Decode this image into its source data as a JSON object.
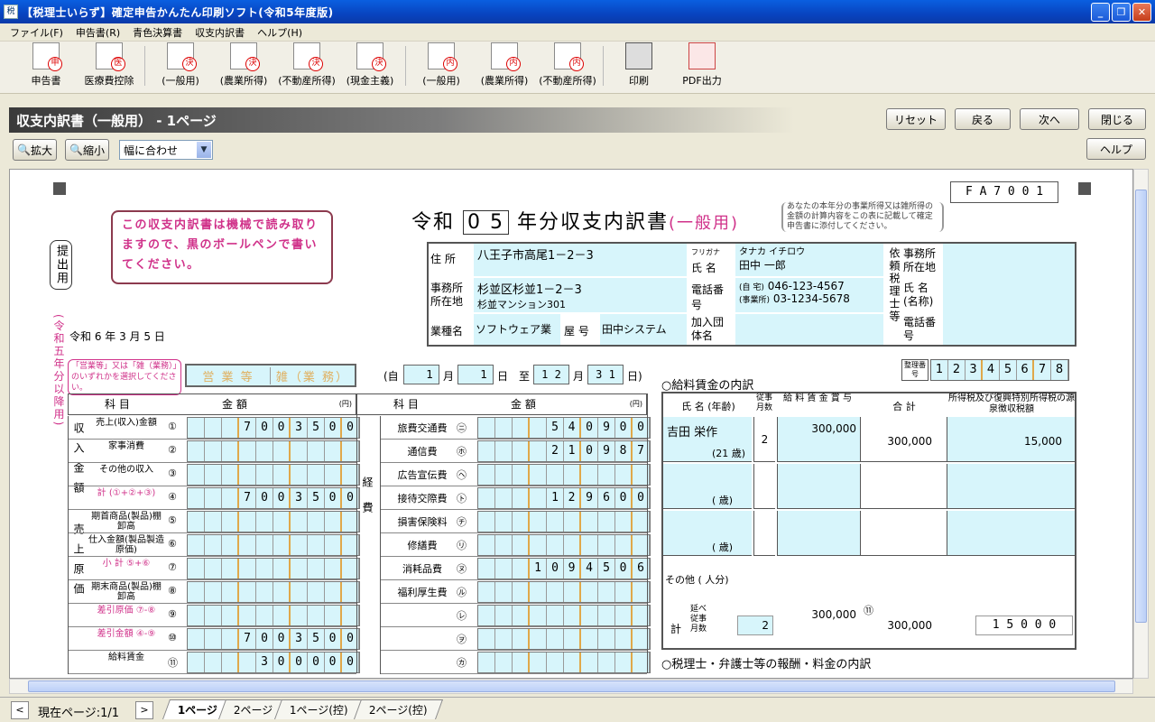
{
  "window": {
    "title": "【税理士いらず】確定申告かんたん印刷ソフト(令和5年度版)"
  },
  "menu": [
    "ファイル(F)",
    "申告書(R)",
    "青色決算書",
    "収支内訳書",
    "ヘルプ(H)"
  ],
  "toolbar": [
    {
      "label": "申告書",
      "badge": "申"
    },
    {
      "label": "医療費控除",
      "badge": "医"
    },
    {
      "label": "(一般用)",
      "badge": "決"
    },
    {
      "label": "(農業所得)",
      "badge": "決"
    },
    {
      "label": "(不動産所得)",
      "badge": "決"
    },
    {
      "label": "(現金主義)",
      "badge": "決"
    },
    {
      "label": "(一般用)",
      "badge": "内"
    },
    {
      "label": "(農業所得)",
      "badge": "内"
    },
    {
      "label": "(不動産所得)",
      "badge": "内"
    },
    {
      "label": "印刷",
      "badge": ""
    },
    {
      "label": "PDF出力",
      "badge": ""
    }
  ],
  "header": {
    "title": "収支内訳書（一般用） - 1ページ"
  },
  "nav": {
    "reset": "リセット",
    "back": "戻る",
    "next": "次へ",
    "close": "閉じる",
    "help": "ヘルプ"
  },
  "zoom": {
    "in": "拡大",
    "out": "縮小",
    "fit": "幅に合わせ"
  },
  "form": {
    "code": "F A 7 0 0 1",
    "title_pre": "令和",
    "year": "0 5",
    "title_post": "年分収支内訳書",
    "title_kind": "(一般用)",
    "note_right": "あなたの本年分の事業所得又は雑所得の金額の計算内容をこの表に記載して確定申告書に添付してください。",
    "notice": "この収支内訳書は機械で読み取りますので、黒のボールペンで書いてください。",
    "submit_label": "提出用",
    "era_label": "(令和五年分以降用)",
    "date": "令和 6 年 3 月 5 日",
    "address_label": "住 所",
    "address": "八王子市高尾1－2－3",
    "furigana_label": "フリガナ",
    "furigana": "タナカ イチロウ",
    "name_label": "氏 名",
    "name": "田中 一郎",
    "office_label": "事務所所在地",
    "office": "杉並区杉並1－2－3",
    "office2": "杉並マンション301",
    "phone_label": "電話番号",
    "phone_home_label": "(自 宅)",
    "phone_home": "046-123-4567",
    "phone_office_label": "(事業所)",
    "phone_office": "03-1234-5678",
    "industry_label": "業種名",
    "industry": "ソフトウェア業",
    "shop_label": "屋 号",
    "shop": "田中システム",
    "group_label": "加入団体名",
    "tax_label": "依頼税理士等",
    "tax_office": "事務所所在地",
    "tax_name": "氏 名(名称)",
    "tax_phone": "電話番号",
    "select_note": "「営業等」又は「雑（業務）」のいずれかを選択してください。",
    "eigyo": "営 業 等",
    "zatsu": "雑（業 務）",
    "period_from": "(自",
    "period_m1": "1",
    "period_d1": "1",
    "period_to": "至",
    "period_m2": "1 2",
    "period_d2": "3 1",
    "period_end": "日)",
    "month_label": "月",
    "day_label": "日",
    "seiri_label": "整理番号",
    "seiri": [
      "1",
      "2",
      "3",
      "4",
      "5",
      "6",
      "7",
      "8"
    ],
    "col_item": "科 目",
    "col_amount": "金 額",
    "yen": "(円)",
    "income_group": "収入金額",
    "cost_group": "売上原価",
    "exp_group": "経費",
    "left_rows": [
      {
        "label": "売上(収入)金額",
        "no": "①",
        "value": "7003500"
      },
      {
        "label": "家事消費",
        "no": "②",
        "value": ""
      },
      {
        "label": "その他の収入",
        "no": "③",
        "value": ""
      },
      {
        "label": "計 (①+②+③)",
        "no": "④",
        "value": "7003500"
      },
      {
        "label": "期首商品(製品)棚卸高",
        "no": "⑤",
        "value": ""
      },
      {
        "label": "仕入金額(製品製造原価)",
        "no": "⑥",
        "value": ""
      },
      {
        "label": "小 計 ⑤+⑥",
        "no": "⑦",
        "value": ""
      },
      {
        "label": "期末商品(製品)棚卸高",
        "no": "⑧",
        "value": ""
      },
      {
        "label": "差引原価 ⑦-⑧",
        "no": "⑨",
        "value": ""
      },
      {
        "label": "差引金額 ④-⑨",
        "no": "⑩",
        "value": "7003500"
      },
      {
        "label": "給料賃金",
        "no": "⑪",
        "value": "300000"
      }
    ],
    "exp_rows": [
      {
        "label": "旅費交通費",
        "no": "㋥",
        "value": "540900"
      },
      {
        "label": "通信費",
        "no": "㋭",
        "value": "210987"
      },
      {
        "label": "広告宣伝費",
        "no": "㋬",
        "value": ""
      },
      {
        "label": "接待交際費",
        "no": "㋣",
        "value": "129600"
      },
      {
        "label": "損害保険料",
        "no": "㋠",
        "value": ""
      },
      {
        "label": "修繕費",
        "no": "㋷",
        "value": ""
      },
      {
        "label": "消耗品費",
        "no": "㋦",
        "value": "1094506"
      },
      {
        "label": "福利厚生費",
        "no": "㋸",
        "value": ""
      },
      {
        "label": "",
        "no": "㋹",
        "value": ""
      },
      {
        "label": "",
        "no": "㋾",
        "value": ""
      },
      {
        "label": "",
        "no": "㋕",
        "value": ""
      }
    ],
    "wage_title": "○給料賃金の内訳",
    "wage_cols": [
      "氏 名 (年齢)",
      "従事月数",
      "給 料 賃 金 賞 与",
      "合 計",
      "所得税及び復興特別所得税の源泉徴収税額"
    ],
    "wage_rows": [
      {
        "name": "吉田 栄作",
        "age": "(21 歳)",
        "months": "2",
        "pay": "300,000",
        "total": "300,000",
        "tax": "15,000"
      },
      {
        "name": "",
        "age": "( 歳)",
        "months": "",
        "pay": "",
        "total": "",
        "tax": ""
      },
      {
        "name": "",
        "age": "( 歳)",
        "months": "",
        "pay": "",
        "total": "",
        "tax": ""
      }
    ],
    "wage_other": "その他 ( 人分)",
    "wage_total_label": "計",
    "wage_total_sub": "延べ従事月数",
    "wage_total_months": "2",
    "wage_total_pay": "300,000",
    "wage_total_total": "300,000",
    "wage_total_tax": "1 5 0 0 0",
    "wage_no": "⑪",
    "fee_title": "○税理士・弁護士等の報酬・料金の内訳"
  },
  "status": {
    "page": "現在ページ:1/1",
    "tabs": [
      "1ページ",
      "2ページ",
      "1ページ(控)",
      "2ページ(控)"
    ]
  }
}
